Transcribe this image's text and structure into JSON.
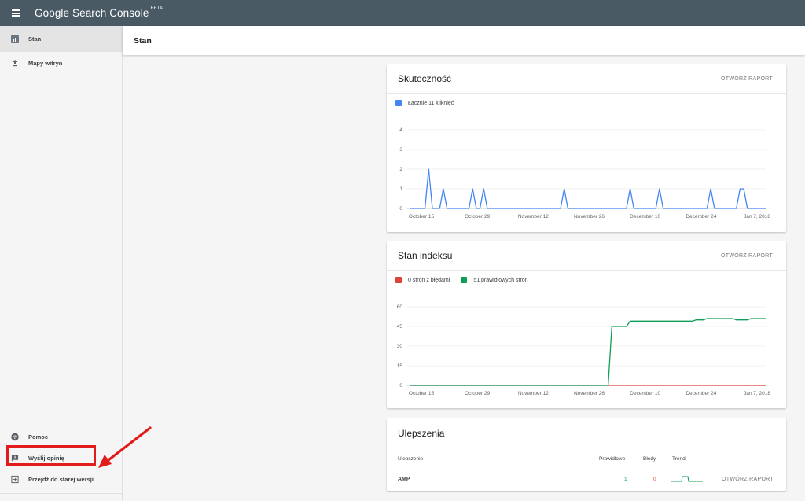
{
  "app": {
    "title": "Google Search Console",
    "badge": "BETA"
  },
  "sidebar": {
    "items": [
      {
        "label": "Stan",
        "icon": "stats-icon",
        "active": true
      },
      {
        "label": "Mapy witryn",
        "icon": "upload-icon",
        "active": false
      }
    ],
    "bottom": [
      {
        "label": "Pomoc",
        "icon": "help-icon"
      },
      {
        "label": "Wyślij opinię",
        "icon": "feedback-icon"
      },
      {
        "label": "Przejdź do starej wersji",
        "icon": "exit-icon"
      }
    ]
  },
  "page": {
    "title": "Stan"
  },
  "colors": {
    "topbar": "#4a5a65",
    "clicks": "#4285f4",
    "errors": "#db4437",
    "valid": "#0f9d58",
    "annotation": "#e21b1b"
  },
  "performance": {
    "title": "Skuteczność",
    "link": "OTWÓRZ RAPORT",
    "legend": "Łącznie 11 kliknięć"
  },
  "index": {
    "title": "Stan indeksu",
    "link": "OTWÓRZ RAPORT",
    "legend_errors": "0 stron z błędami",
    "legend_valid": "51 prawidłowych stron"
  },
  "enhancements": {
    "title": "Ulepszenia",
    "columns": {
      "name": "Ulepszenie",
      "valid": "Prawidłowe",
      "errors": "Błędy",
      "trend": "Trend"
    },
    "rows": [
      {
        "name": "AMP",
        "valid": "1",
        "errors": "0",
        "link": "OTWÓRZ RAPORT"
      }
    ]
  },
  "chart_data": [
    {
      "type": "line",
      "title": "Skuteczność",
      "x_tick_labels": [
        "October 15",
        "October 29",
        "November 12",
        "November 26",
        "December 10",
        "December 24",
        "Jan 7, 2018"
      ],
      "ylim": [
        0,
        4
      ],
      "y_ticks": [
        0,
        1,
        2,
        3,
        4
      ],
      "series": [
        {
          "name": "Łącznie 11 kliknięć",
          "color": "#4285f4",
          "values": [
            0,
            0,
            0,
            0,
            0,
            2,
            0,
            0,
            0,
            1,
            0,
            0,
            0,
            0,
            0,
            0,
            0,
            1,
            0,
            0,
            1,
            0,
            0,
            0,
            0,
            0,
            0,
            0,
            0,
            0,
            0,
            0,
            0,
            0,
            0,
            0,
            0,
            0,
            0,
            0,
            0,
            0,
            1,
            0,
            0,
            0,
            0,
            0,
            0,
            0,
            0,
            0,
            0,
            0,
            0,
            0,
            0,
            0,
            0,
            0,
            1,
            0,
            0,
            0,
            0,
            0,
            0,
            0,
            1,
            0,
            0,
            0,
            0,
            0,
            0,
            0,
            0,
            0,
            0,
            0,
            0,
            0,
            1,
            0,
            0,
            0,
            0,
            0,
            0,
            0,
            1,
            1,
            0,
            0,
            0,
            0,
            0,
            0
          ]
        }
      ],
      "grid": true
    },
    {
      "type": "line",
      "title": "Stan indeksu",
      "x_tick_labels": [
        "October 15",
        "October 29",
        "November 12",
        "November 26",
        "December 10",
        "December 24",
        "Jan 7, 2018"
      ],
      "ylim": [
        0,
        60
      ],
      "y_ticks": [
        0,
        15,
        30,
        45,
        60
      ],
      "series": [
        {
          "name": "0 stron z błędami",
          "color": "#db4437",
          "values": [
            0,
            0,
            0,
            0,
            0,
            0,
            0,
            0,
            0,
            0,
            0,
            0,
            0,
            0,
            0,
            0,
            0,
            0,
            0,
            0,
            0,
            0,
            0,
            0,
            0,
            0,
            0,
            0,
            0,
            0,
            0,
            0,
            0,
            0,
            0,
            0,
            0,
            0,
            0,
            0,
            0,
            0,
            0,
            0,
            0,
            0,
            0,
            0,
            0,
            0,
            0,
            0,
            0,
            0,
            0,
            0,
            0,
            0,
            0,
            0,
            0,
            0,
            0,
            0,
            0,
            0,
            0,
            0,
            0,
            0,
            0,
            0,
            0,
            0,
            0,
            0,
            0,
            0,
            0,
            0,
            0,
            0,
            0,
            0,
            0,
            0,
            0,
            0,
            0,
            0,
            0,
            0,
            0,
            0,
            0,
            0,
            0,
            0
          ]
        },
        {
          "name": "51 prawidłowych stron",
          "color": "#0f9d58",
          "values": [
            0,
            0,
            0,
            0,
            0,
            0,
            0,
            0,
            0,
            0,
            0,
            0,
            0,
            0,
            0,
            0,
            0,
            0,
            0,
            0,
            0,
            0,
            0,
            0,
            0,
            0,
            0,
            0,
            0,
            0,
            0,
            0,
            0,
            0,
            0,
            0,
            0,
            0,
            0,
            0,
            0,
            0,
            0,
            0,
            0,
            0,
            0,
            0,
            0,
            0,
            0,
            0,
            0,
            0,
            0,
            45,
            45,
            45,
            45,
            45,
            49,
            49,
            49,
            49,
            49,
            49,
            49,
            49,
            49,
            49,
            49,
            49,
            49,
            49,
            49,
            49,
            49,
            49,
            50,
            50,
            50,
            51,
            51,
            51,
            51,
            51,
            51,
            51,
            51,
            50,
            50,
            50,
            50,
            51,
            51,
            51,
            51,
            51
          ]
        }
      ],
      "grid": true
    }
  ]
}
